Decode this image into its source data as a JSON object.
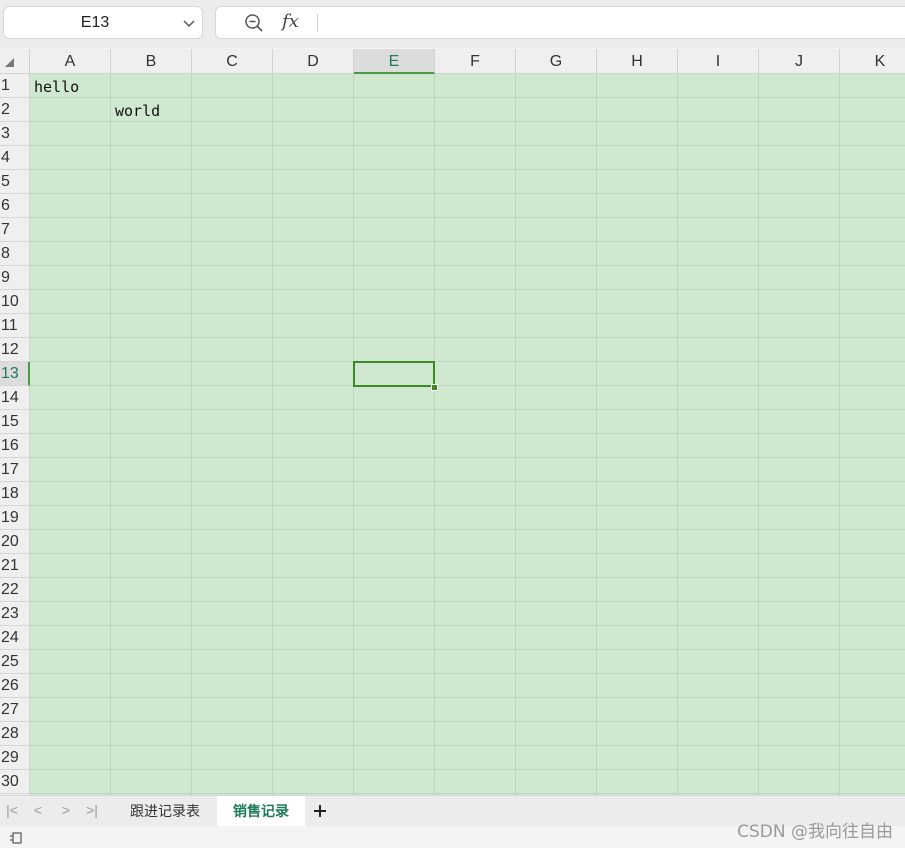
{
  "formula_bar": {
    "name_box": "E13",
    "fx_label": "fx",
    "formula": ""
  },
  "columns": [
    "A",
    "B",
    "C",
    "D",
    "E",
    "F",
    "G",
    "H",
    "I",
    "J",
    "K"
  ],
  "rows": [
    "1",
    "2",
    "3",
    "4",
    "5",
    "6",
    "7",
    "8",
    "9",
    "10",
    "11",
    "12",
    "13",
    "14",
    "15",
    "16",
    "17",
    "18",
    "19",
    "20",
    "21",
    "22",
    "23",
    "24",
    "25",
    "26",
    "27",
    "28",
    "29",
    "30"
  ],
  "active_cell": {
    "column": "E",
    "row": "13"
  },
  "cells": [
    {
      "ref": "A1",
      "column": "A",
      "row": "1",
      "value": "hello"
    },
    {
      "ref": "B2",
      "column": "B",
      "row": "2",
      "value": "world"
    }
  ],
  "sheet_tabs": [
    {
      "label": "跟进记录表",
      "active": false
    },
    {
      "label": "销售记录",
      "active": true
    }
  ],
  "watermark": "CSDN @我向往自由",
  "colors": {
    "cell_background": "#cfe8cf",
    "selection_border": "#3a8a2a",
    "active_header_text": "#1f7a5c"
  }
}
